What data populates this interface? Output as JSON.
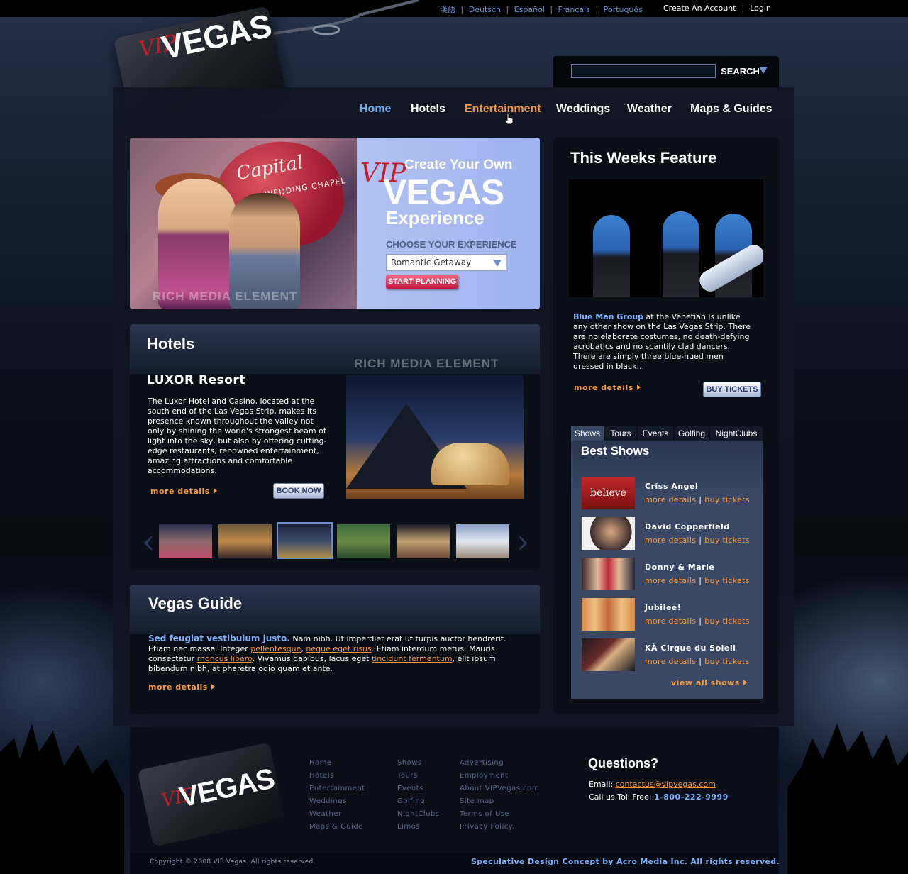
{
  "topbar": {
    "languages": [
      "漢語",
      "Deutsch",
      "Español",
      "Français",
      "Português"
    ],
    "create_account": "Create An Account",
    "login": "Login"
  },
  "logo": {
    "vip": "VIP",
    "vegas": "VEGAS"
  },
  "search": {
    "label": "SEARCH",
    "value": ""
  },
  "nav": [
    "Home",
    "Hotels",
    "Entertainment",
    "Weddings",
    "Weather",
    "Maps & Guides"
  ],
  "hero": {
    "line1": "Create Your Own",
    "line2": "VEGAS",
    "line3": "Experience",
    "choose_label": "CHOOSE YOUR EXPERIENCE",
    "select_value": "Romantic Getaway",
    "button": "START PLANNING",
    "heart_title": "Capital",
    "heart_sub": "WEDDING CHAPEL",
    "watermark": "RICH MEDIA ELEMENT"
  },
  "hotels": {
    "title": "Hotels",
    "watermark": "RICH MEDIA ELEMENT",
    "name": "LUXOR Resort",
    "description": "The Luxor Hotel and Casino, located at the south end of the Las Vegas Strip, makes its presence known throughout the valley not only by shining the world's strongest beam of light into the sky, but also by offering cutting-edge restaurants, renowned entertainment, amazing attractions and comfortable accommodations.",
    "more": "more details",
    "book": "BOOK NOW"
  },
  "guide": {
    "title": "Vegas Guide",
    "lead": "Sed feugiat vestibulum justo.",
    "t1": " Nam nibh. Ut imperdiet erat ut turpis auctor hendrerit. Etiam nec massa. Integer ",
    "link1": "pellentesque",
    "t2": ", ",
    "link2": "neque eget risus",
    "t3": ". Etiam interdum metus. Mauris consectetur ",
    "link3": "rhoncus libero",
    "t4": ". Vivamus dapibus, lacus eget ",
    "link4": "tincidunt fermentum",
    "t5": ", elit ipsum bibendum nibh, at pharetra odio quam et ante.",
    "more": "more details"
  },
  "feature": {
    "title": "This Weeks Feature",
    "lead": "Blue Man Group",
    "text": " at the Venetian is unlike any other show on the Las Vegas Strip. There are no elaborate costumes, no death-defying acrobatics and no scantily clad dancers. There are simply three blue-hued men dressed in black...",
    "more": "more details",
    "buy": "BUY TICKETS"
  },
  "tabs": [
    "Shows",
    "Tours",
    "Events",
    "Golfing",
    "NightClubs"
  ],
  "best_shows": {
    "title": "Best Shows",
    "items": [
      {
        "name": "Criss Angel",
        "more": "more details",
        "buy": "buy tickets"
      },
      {
        "name": "David Copperfield",
        "more": "more details",
        "buy": "buy tickets"
      },
      {
        "name": "Donny & Marie",
        "more": "more details",
        "buy": "buy tickets"
      },
      {
        "name": "Jubilee!",
        "more": "more details",
        "buy": "buy tickets"
      },
      {
        "name": "KÀ Cirque du Soleil",
        "more": "more details",
        "buy": "buy tickets"
      }
    ],
    "view_all": "view all shows",
    "criss_logo": "believe"
  },
  "footer": {
    "col1": [
      "Home",
      "Hotels",
      "Entertainment",
      "Weddings",
      "Weather",
      "Maps & Guide"
    ],
    "col2": [
      "Shows",
      "Tours",
      "Events",
      "Golfing",
      "NightClubs",
      "Limos"
    ],
    "col3": [
      "Advertising",
      "Employment",
      "About VIPVegas.com",
      "Site map",
      "Terms of Use",
      "Privacy Policy."
    ],
    "questions": "Questions?",
    "email_label": "Email:",
    "email": "contactus@vipvegas.com",
    "phone_label": "Call us Toll Free:",
    "phone": "1-800-222-9999",
    "copyright": "Copyright © 2008 VIP Vegas. All rights reserved.",
    "spec": "Speculative Design Concept by Acro Media Inc. All rights reserved."
  },
  "colors": {
    "accent_orange": "#f39a40",
    "accent_blue": "#7bb0ff",
    "brand_red": "#c0202a"
  }
}
